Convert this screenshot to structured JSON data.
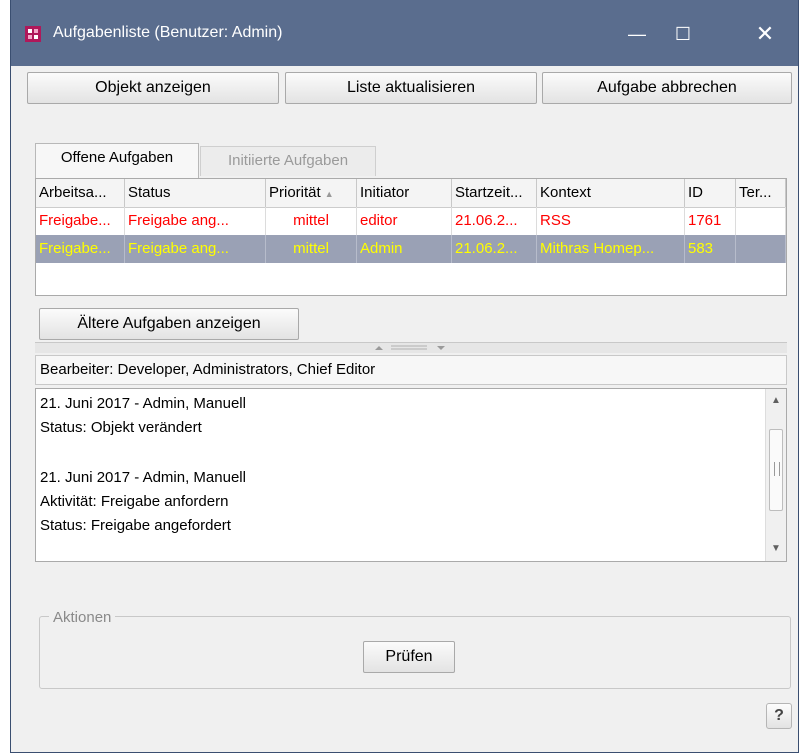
{
  "window": {
    "title": "Aufgabenliste (Benutzer: Admin)",
    "controls": {
      "minimize": "—",
      "maximize": "☐",
      "close": "✕"
    }
  },
  "toolbar": {
    "show_object": "Objekt anzeigen",
    "refresh_list": "Liste aktualisieren",
    "cancel_task": "Aufgabe abbrechen"
  },
  "tabs": [
    {
      "label": "Offene Aufgaben",
      "active": true
    },
    {
      "label": "Initiierte Aufgaben",
      "active": false
    }
  ],
  "table": {
    "columns": [
      "Arbeitsa...",
      "Status",
      "Priorität",
      "Initiator",
      "Startzeit...",
      "Kontext",
      "ID",
      "Ter..."
    ],
    "sort_indicator": "▲",
    "rows": [
      {
        "cells": [
          "Freigabe...",
          "Freigabe ang...",
          "mittel",
          "editor",
          "21.06.2...",
          "RSS",
          "1761",
          ""
        ],
        "selected": false
      },
      {
        "cells": [
          "Freigabe...",
          "Freigabe ang...",
          "mittel",
          "Admin",
          "21.06.2...",
          "Mithras Homep...",
          "583",
          ""
        ],
        "selected": true
      }
    ]
  },
  "older_tasks_button": "Ältere Aufgaben anzeigen",
  "editors_line": "Bearbeiter: Developer, Administrators, Chief Editor",
  "log": [
    "21. Juni 2017 - Admin, Manuell",
    "Status: Objekt verändert",
    "",
    "21. Juni 2017 - Admin, Manuell",
    "Aktivität: Freigabe anfordern",
    "Status: Freigabe angefordert"
  ],
  "actions": {
    "legend": "Aktionen",
    "check_button": "Prüfen"
  },
  "help": "?",
  "colors": {
    "titlebar": "#5a6d8e",
    "row_text_red": "#ff0000",
    "row_selected_bg": "#9aa1b5",
    "row_selected_text": "#ffff00"
  }
}
